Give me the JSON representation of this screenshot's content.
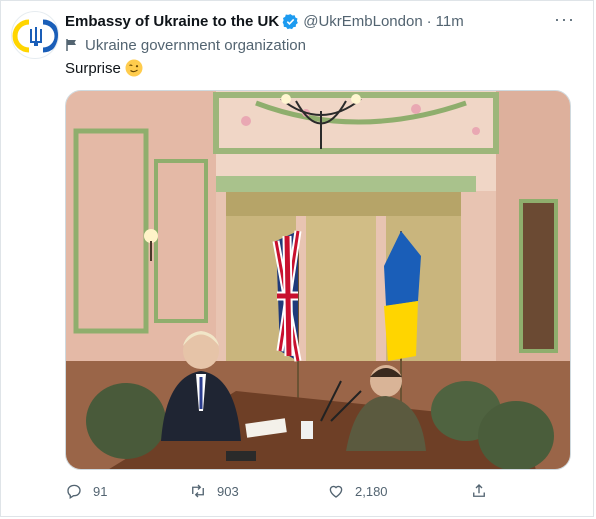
{
  "author": {
    "name": "Embassy of Ukraine to the UK",
    "handle": "@UkrEmbLondon",
    "time": "11m",
    "affiliation": "Ukraine government organization"
  },
  "tweet": {
    "text": "Surprise"
  },
  "actions": {
    "replies": "91",
    "retweets": "903",
    "likes": "2,180"
  },
  "colors": {
    "ukraine_blue": "#1a5eb8",
    "ukraine_yellow": "#ffd500",
    "verified": "#1d9bf0",
    "muted": "#536471"
  },
  "icons": [
    "ukraine-trident-icon",
    "verified-badge-icon",
    "more-icon",
    "flag-icon",
    "wink-emoji-icon",
    "reply-icon",
    "retweet-icon",
    "like-icon",
    "share-icon"
  ]
}
